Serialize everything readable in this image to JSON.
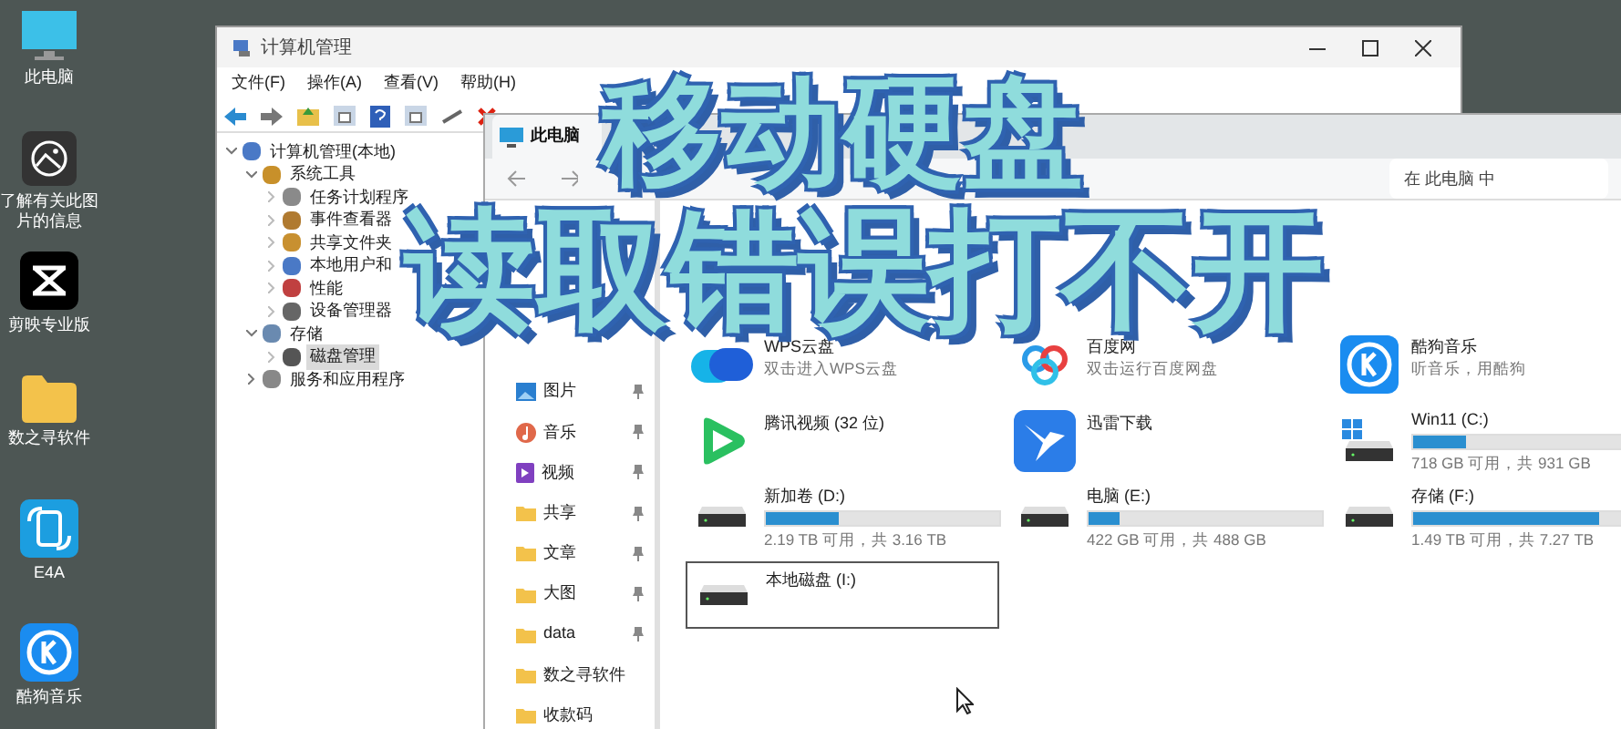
{
  "desktop_icons": [
    {
      "label": "此电脑",
      "kind": "pc"
    },
    {
      "label": "了解有关此图片的信息",
      "kind": "info"
    },
    {
      "label": "剪映专业版",
      "kind": "capcut"
    },
    {
      "label": "数之寻软件",
      "kind": "folder"
    },
    {
      "label": "E4A",
      "kind": "e4a"
    },
    {
      "label": "酷狗音乐",
      "kind": "kugou"
    }
  ],
  "mgmt_window": {
    "title": "计算机管理",
    "menu": [
      "文件(F)",
      "操作(A)",
      "查看(V)",
      "帮助(H)"
    ],
    "tree": [
      {
        "label": "计算机管理(本地)",
        "expanded": true,
        "selected": false,
        "children": [
          {
            "label": "系统工具",
            "expanded": true,
            "selected": false,
            "children": [
              {
                "label": "任务计划程序",
                "selected": false
              },
              {
                "label": "事件查看器",
                "selected": false
              },
              {
                "label": "共享文件夹",
                "selected": false
              },
              {
                "label": "本地用户和",
                "selected": false
              },
              {
                "label": "性能",
                "selected": false
              },
              {
                "label": "设备管理器",
                "selected": false
              }
            ]
          },
          {
            "label": "存储",
            "expanded": true,
            "selected": false,
            "children": [
              {
                "label": "磁盘管理",
                "selected": true
              }
            ]
          },
          {
            "label": "服务和应用程序",
            "expanded": false,
            "selected": false
          }
        ]
      }
    ]
  },
  "explorer": {
    "tab": "此电脑",
    "search": {
      "placeholder": "在 此电脑 中"
    },
    "nav": [
      {
        "label": "图片",
        "kind": "pictures",
        "pinned": true
      },
      {
        "label": "音乐",
        "kind": "music",
        "pinned": true
      },
      {
        "label": "视频",
        "kind": "video",
        "pinned": true
      },
      {
        "label": "共享",
        "kind": "folder",
        "pinned": true
      },
      {
        "label": "文章",
        "kind": "folder",
        "pinned": true
      },
      {
        "label": "大图",
        "kind": "folder",
        "pinned": true
      },
      {
        "label": "data",
        "kind": "folder",
        "pinned": true
      },
      {
        "label": "数之寻软件",
        "kind": "folder",
        "pinned": false
      },
      {
        "label": "收款码",
        "kind": "folder",
        "pinned": false
      }
    ],
    "items": [
      {
        "kind": "app",
        "name": "WPS云盘",
        "subtitle": "双击进入WPS云盘",
        "selected": false
      },
      {
        "kind": "app",
        "name": "百度网",
        "subtitle": "双击运行百度网盘",
        "selected": false
      },
      {
        "kind": "app",
        "name": "酷狗音乐",
        "subtitle": "听音乐，用酷狗",
        "selected": false
      },
      {
        "kind": "app",
        "name": "腾讯视频 (32 位)",
        "selected": false
      },
      {
        "kind": "app",
        "name": "迅雷下载",
        "selected": false
      },
      {
        "kind": "drive",
        "system": true,
        "name": "Win11 (C:)",
        "level": 0.23,
        "reading": "718 GB 可用，共 931 GB",
        "selected": false
      },
      {
        "kind": "drive",
        "system": false,
        "name": "新加卷 (D:)",
        "level": 0.31,
        "reading": "2.19 TB 可用，共 3.16 TB",
        "selected": false
      },
      {
        "kind": "drive",
        "system": false,
        "name": "电脑 (E:)",
        "level": 0.135,
        "reading": "422 GB 可用，共 488 GB",
        "selected": false
      },
      {
        "kind": "drive",
        "system": false,
        "name": "存储 (F:)",
        "level": 0.8,
        "reading": "1.49 TB 可用，共 7.27 TB",
        "selected": false
      },
      {
        "kind": "drive",
        "system": false,
        "name": "本地磁盘 (I:)",
        "selected": true
      }
    ]
  },
  "headline": [
    "移动硬盘",
    "读取错误打不开"
  ]
}
